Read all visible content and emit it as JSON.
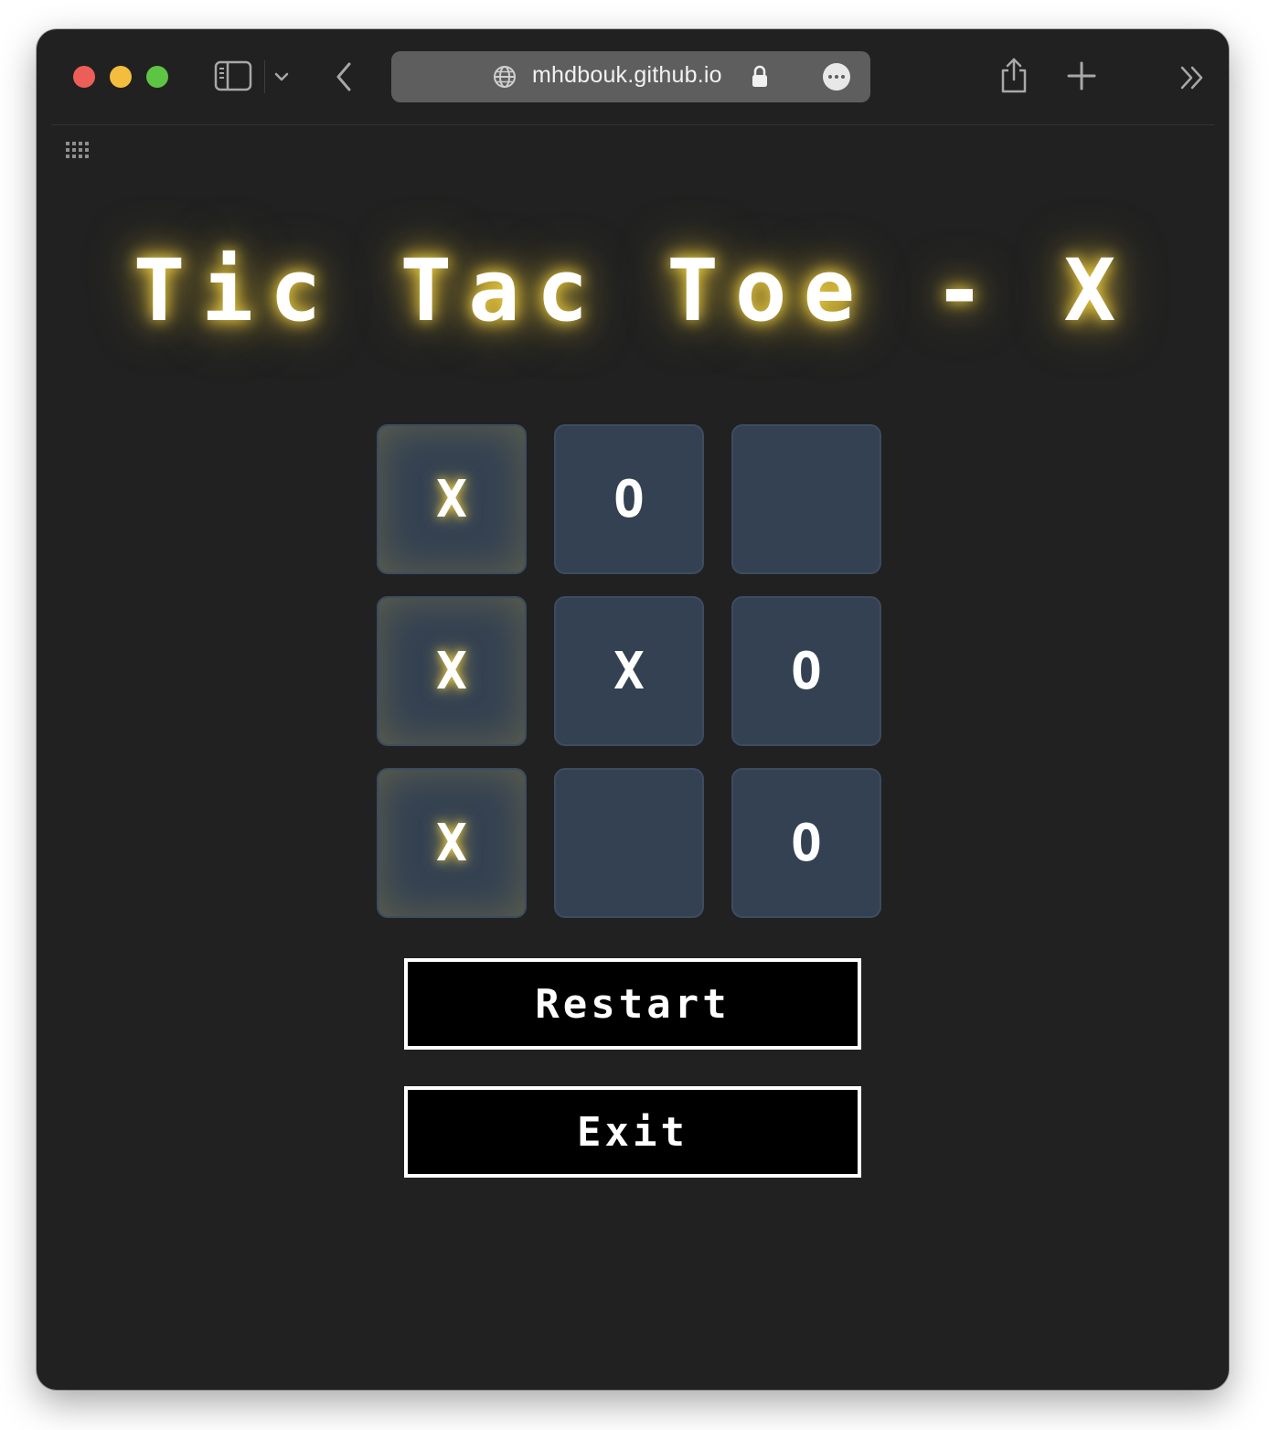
{
  "browser": {
    "url": "mhdbouk.github.io",
    "icons": {
      "traffic_close": "close-dot",
      "traffic_minimize": "minimize-dot",
      "traffic_zoom": "zoom-dot",
      "sidebar": "sidebar-toggle-icon",
      "tab_group_menu": "chevron-down-icon",
      "back": "chevron-left-icon",
      "site": "globe-icon",
      "secure": "lock-icon",
      "page_menu": "ellipsis-icon",
      "share": "share-icon",
      "new_tab": "plus-icon",
      "overflow": "double-chevron-right-icon",
      "grid": "grid-icon"
    },
    "colors": {
      "close": "#ec5f58",
      "minimize": "#f4bd3d",
      "zoom": "#5ec443"
    }
  },
  "game": {
    "title_words": [
      "Tic",
      "Tac",
      "Toe",
      "-",
      "X"
    ],
    "board": [
      [
        "X",
        "O",
        ""
      ],
      [
        "X",
        "X",
        "O"
      ],
      [
        "X",
        "",
        "O"
      ]
    ],
    "winning_cells": [
      [
        0,
        0
      ],
      [
        1,
        0
      ],
      [
        2,
        0
      ]
    ],
    "restart_label": "Restart",
    "exit_label": "Exit",
    "colors": {
      "background": "#212121",
      "cell": "#334152",
      "glow": "#f0cf48"
    }
  }
}
